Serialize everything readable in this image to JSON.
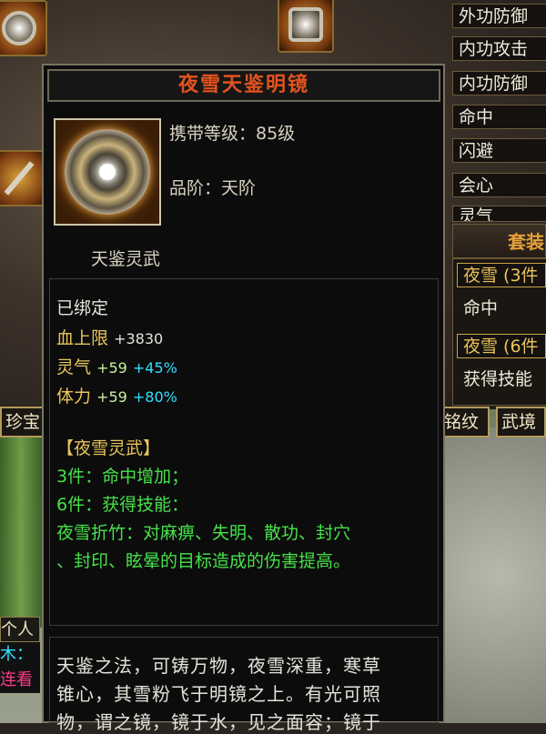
{
  "tooltip": {
    "title": "夜雪天鉴明镜",
    "carry_level": "携带等级：85级",
    "grade": "品阶：天阶",
    "category": "天鉴灵武",
    "bound": "已绑定",
    "stats": [
      {
        "label": "血上限",
        "value": "+3830",
        "pct": ""
      },
      {
        "label": "灵气",
        "value": "+59",
        "pct": "+45%"
      },
      {
        "label": "体力",
        "value": "+59",
        "pct": "+80%"
      }
    ],
    "set_name": "【夜雪灵武】",
    "set_3": "3件：命中增加；",
    "set_6": "6件：获得技能：",
    "skill_line1": "夜雪折竹：对麻痹、失明、散功、封穴",
    "skill_line2": "、封印、眩晕的目标造成的伤害提高。",
    "desc_line1": "天鉴之法，可铸万物，夜雪深重，寒草",
    "desc_line2": "锥心，其雪粉飞于明镜之上。有光可照",
    "desc_line3": "物，谓之镜，镜于水，见之面容；镜于"
  },
  "right_menu": [
    "外功防御",
    "内功攻击",
    "内功防御",
    "命中",
    "闪避",
    "会心",
    "灵气"
  ],
  "right_panel": {
    "title": "套装",
    "items": [
      "夜雪 (3件",
      "命中",
      "夜雪 (6件",
      "获得技能"
    ]
  },
  "bottom_tabs": {
    "left": "珍宝",
    "right1": "铭纹",
    "right2": "武境"
  },
  "left_chat": {
    "personal": "个人",
    "line1": "木：",
    "line2": "连看"
  }
}
